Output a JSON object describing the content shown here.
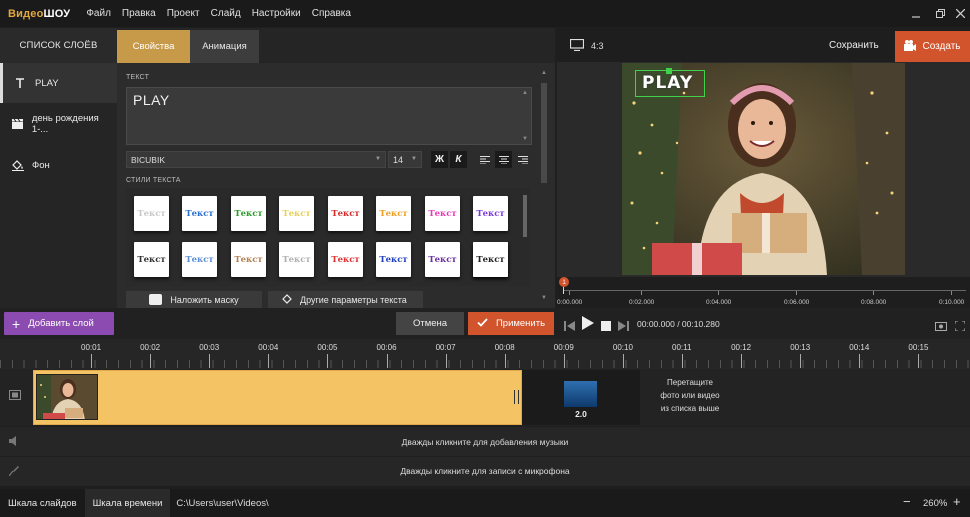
{
  "app": {
    "logo_a": "Видео",
    "logo_b": "ШОУ"
  },
  "menu": [
    "Файл",
    "Правка",
    "Проект",
    "Слайд",
    "Настройки",
    "Справка"
  ],
  "window_controls": [
    "minimize-icon",
    "maximize-icon",
    "close-icon"
  ],
  "layers": {
    "title": "СПИСОК СЛОЁВ",
    "items": [
      {
        "label": "PLAY",
        "icon": "text-icon"
      },
      {
        "label": "день рождения 1-...",
        "icon": "clapper-icon"
      },
      {
        "label": "Фон",
        "icon": "paint-bucket-icon"
      }
    ]
  },
  "tabs": {
    "properties": "Свойства",
    "animation": "Анимация"
  },
  "props": {
    "text_label": "ТЕКСТ",
    "text_value": "PLAY",
    "font": "BICUBIK",
    "size": "14",
    "bold": "Ж",
    "italic": "К",
    "styles_label": "СТИЛИ ТЕКСТА",
    "style_sample": "Текст",
    "mask_button": "Наложить маску",
    "more_button": "Другие параметры текста"
  },
  "text_styles": [
    {
      "color": "#c8c8c8"
    },
    {
      "color": "#2b6fd4"
    },
    {
      "color": "#2a9b2a"
    },
    {
      "color": "#e6d05a"
    },
    {
      "color": "#d82a2a"
    },
    {
      "color": "#f0a020"
    },
    {
      "color": "#e63ab8"
    },
    {
      "color": "#7a3ad8"
    },
    {
      "color": "#333333"
    },
    {
      "color": "#5a8fd8"
    },
    {
      "color": "#b08050"
    },
    {
      "color": "#b0b0b0"
    },
    {
      "color": "#e03030"
    },
    {
      "color": "#2040c0"
    },
    {
      "color": "#6a30a0"
    },
    {
      "color": "#c030c0"
    },
    {
      "color": "#222222"
    }
  ],
  "preview": {
    "ratio": "4:3",
    "save": "Сохранить",
    "create": "Создать",
    "overlay_text": "PLAY"
  },
  "mini_timeline": [
    "0:00.000",
    "0:02.000",
    "0:04.000",
    "0:06.000",
    "0:08.000",
    "0:10.000"
  ],
  "mini_marker": "1",
  "controls": {
    "add_layer": "Добавить слой",
    "cancel": "Отмена",
    "apply": "Применить",
    "time_current": "00:00.000",
    "time_total": "00:10.280",
    "time_sep": " / "
  },
  "ruler": [
    "00:01",
    "00:02",
    "00:03",
    "00:04",
    "00:05",
    "00:06",
    "00:07",
    "00:08",
    "00:09",
    "00:10",
    "00:11",
    "00:12",
    "00:13",
    "00:14",
    "00:15"
  ],
  "timeline": {
    "slide2_duration": "2.0",
    "drop_hint_1": "Перетащите",
    "drop_hint_2": "фото или видео",
    "drop_hint_3": "из списка выше",
    "music_hint": "Дважды кликните для добавления музыки",
    "mic_hint": "Дважды кликните для записи с микрофона"
  },
  "statusbar": {
    "tab_slides": "Шкала слайдов",
    "tab_timeline": "Шкала времени",
    "path": "C:\\Users\\user\\Videos\\",
    "zoom": "260%",
    "minus": "−",
    "plus": "+"
  }
}
